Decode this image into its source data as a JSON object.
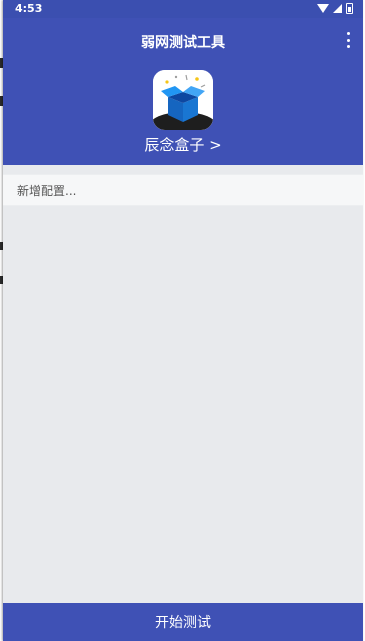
{
  "status_bar": {
    "time": "4:53",
    "icons": [
      "wifi-icon",
      "signal-icon",
      "battery-icon"
    ]
  },
  "header": {
    "title": "弱网测试工具",
    "menu_icon": "more-vert-icon",
    "app_icon": "gift-box-icon",
    "app_name": "辰念盒子 >"
  },
  "main": {
    "add_config_label": "新增配置..."
  },
  "footer": {
    "start_button_label": "开始测试"
  },
  "colors": {
    "primary": "#3f51b5",
    "status_bar": "#3b4fb0",
    "background": "#e8eaed",
    "row_background": "#f6f7f8"
  }
}
